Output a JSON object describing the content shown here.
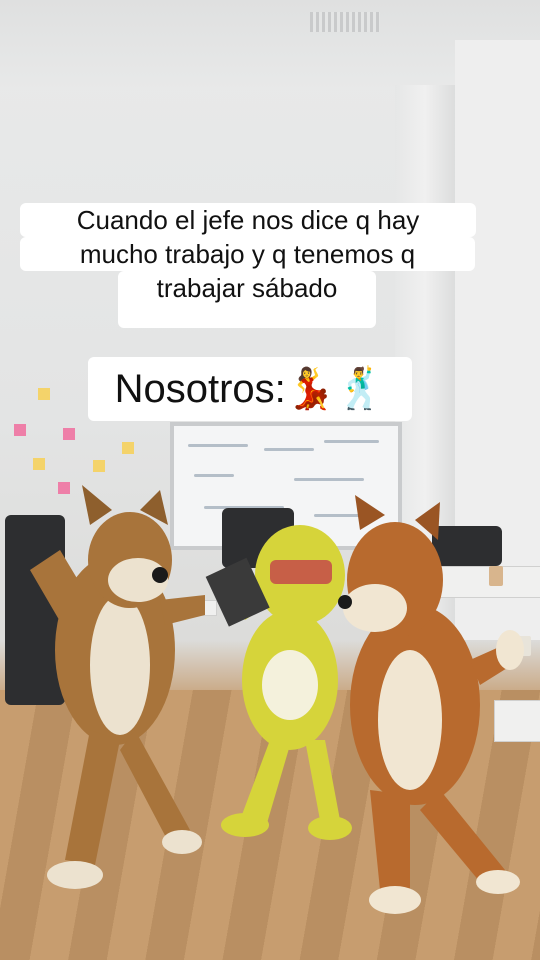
{
  "caption": {
    "line1": "Cuando el jefe nos dice q hay",
    "line2": "mucho trabajo y q tenemos q",
    "line3": "trabajar sábado",
    "line4": "Nosotros:💃🕺"
  },
  "colors": {
    "wolf": "#b07a3f",
    "yellow_dog": "#d8d63a",
    "tiger": "#b86a2e",
    "caption_bg": "#ffffff",
    "caption_text": "#111111"
  }
}
